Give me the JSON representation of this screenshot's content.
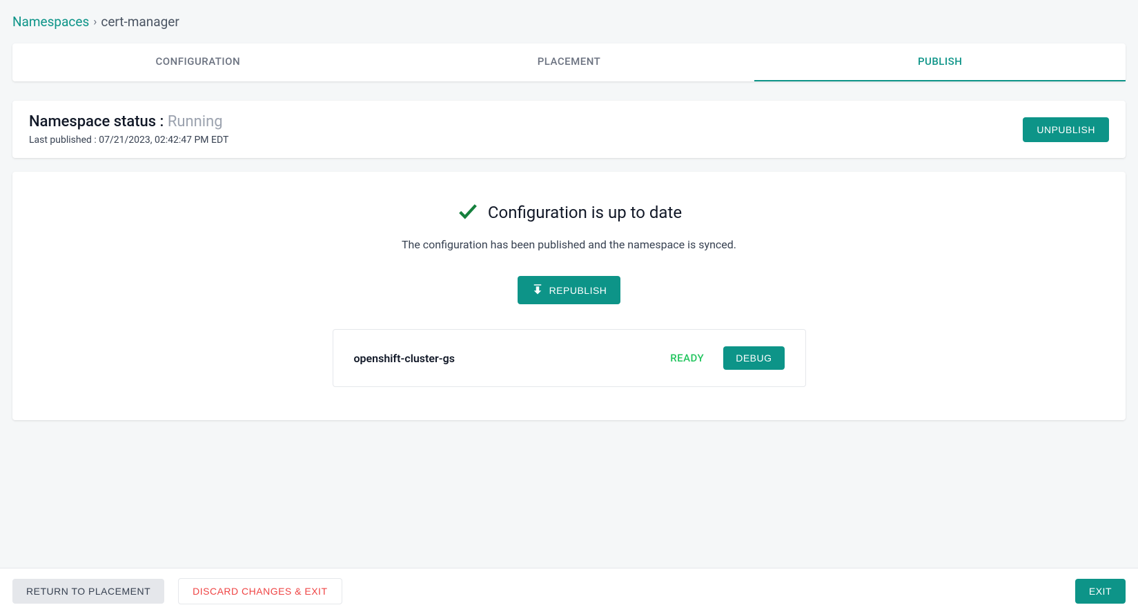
{
  "breadcrumb": {
    "root": "Namespaces",
    "sep": "›",
    "current": "cert-manager"
  },
  "tabs": {
    "configuration": "CONFIGURATION",
    "placement": "PLACEMENT",
    "publish": "PUBLISH"
  },
  "status": {
    "label": "Namespace status : ",
    "value": "Running",
    "last_published_label": "Last published : ",
    "last_published_value": "07/21/2023, 02:42:47 PM EDT",
    "unpublish_label": "UNPUBLISH"
  },
  "sync": {
    "title": "Configuration is up to date",
    "description": "The configuration has been published and the namespace is synced.",
    "republish_label": "REPUBLISH"
  },
  "cluster": {
    "name": "openshift-cluster-gs",
    "status": "READY",
    "debug_label": "DEBUG"
  },
  "footer": {
    "return_label": "RETURN TO PLACEMENT",
    "discard_label": "DISCARD CHANGES & EXIT",
    "exit_label": "EXIT"
  }
}
